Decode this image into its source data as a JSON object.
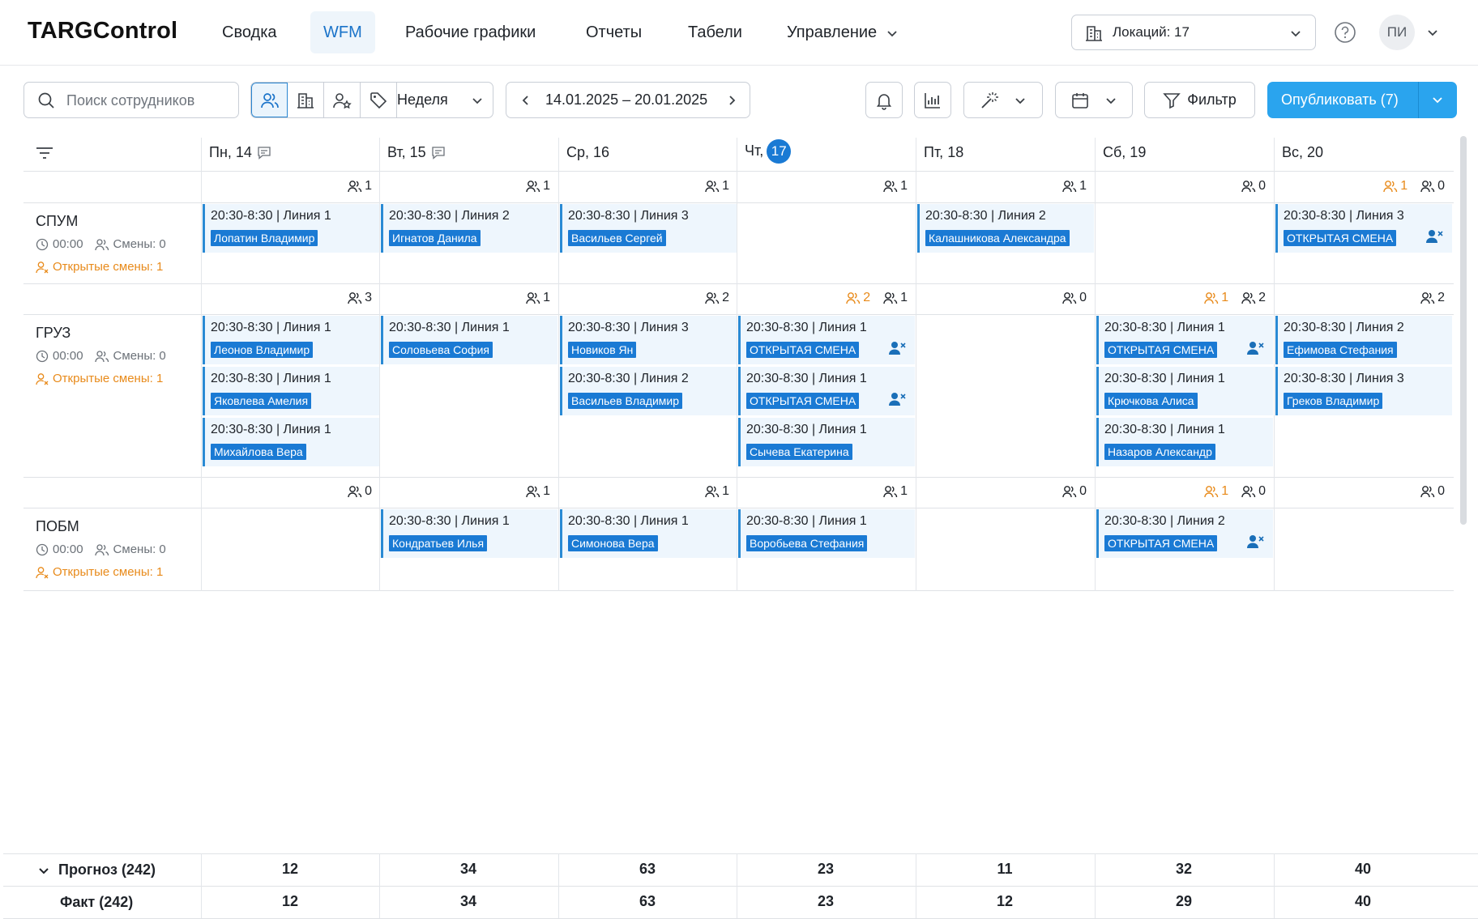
{
  "app": {
    "logo": "TARGControl"
  },
  "nav": {
    "items": [
      {
        "label": "Сводка",
        "active": false
      },
      {
        "label": "WFM",
        "active": true
      },
      {
        "label": "Рабочие графики",
        "active": false
      },
      {
        "label": "Отчеты",
        "active": false
      },
      {
        "label": "Табели",
        "active": false
      },
      {
        "label": "Управление",
        "active": false,
        "has_dropdown": true
      }
    ],
    "locations_label": "Локаций: 17",
    "user_initials": "ПИ"
  },
  "toolbar": {
    "search_placeholder": "Поиск сотрудников",
    "period_label": "Неделя",
    "date_range": "14.01.2025 – 20.01.2025",
    "filter_label": "Фильтр",
    "publish_label": "Опубликовать (7)"
  },
  "colors": {
    "accent": "#1a7ad4",
    "publish": "#2aa4ee",
    "open_shift": "#e88a1a",
    "shift_bg": "#eef6fd"
  },
  "days": [
    {
      "label": "Пн, 14",
      "has_comment": true,
      "today": false
    },
    {
      "label": "Вт, 15",
      "has_comment": true,
      "today": false
    },
    {
      "label": "Ср, 16",
      "has_comment": false,
      "today": false
    },
    {
      "label": "Чт,",
      "date": "17",
      "has_comment": false,
      "today": true
    },
    {
      "label": "Пт, 18",
      "has_comment": false,
      "today": false
    },
    {
      "label": "Сб, 19",
      "has_comment": false,
      "today": false
    },
    {
      "label": "Вс, 20",
      "has_comment": false,
      "today": false
    }
  ],
  "groups": [
    {
      "name": "СПУМ",
      "time": "00:00",
      "shifts_label": "Смены: 0",
      "open_label": "Открытые смены: 1",
      "counts": [
        {
          "open": null,
          "staff": "1"
        },
        {
          "open": null,
          "staff": "1"
        },
        {
          "open": null,
          "staff": "1"
        },
        {
          "open": null,
          "staff": "1"
        },
        {
          "open": null,
          "staff": "1"
        },
        {
          "open": null,
          "staff": "0"
        },
        {
          "open": "1",
          "staff": "0"
        }
      ],
      "cells": [
        [
          {
            "time": "20:30-8:30 | Линия 1",
            "employee": "Лопатин Владимир",
            "open": false
          }
        ],
        [
          {
            "time": "20:30-8:30 | Линия 2",
            "employee": "Игнатов Данила",
            "open": false
          }
        ],
        [
          {
            "time": "20:30-8:30 | Линия 3",
            "employee": "Васильев Сергей",
            "open": false
          }
        ],
        [],
        [
          {
            "time": "20:30-8:30 | Линия 2",
            "employee": "Калашникова Александра",
            "open": false
          }
        ],
        [],
        [
          {
            "time": "20:30-8:30 | Линия 3",
            "employee": "ОТКРЫТАЯ СМЕНА",
            "open": true
          }
        ]
      ]
    },
    {
      "name": "ГРУЗ",
      "time": "00:00",
      "shifts_label": "Смены: 0",
      "open_label": "Открытые смены: 1",
      "counts": [
        {
          "open": null,
          "staff": "3"
        },
        {
          "open": null,
          "staff": "1"
        },
        {
          "open": null,
          "staff": "2"
        },
        {
          "open": "2",
          "staff": "1"
        },
        {
          "open": null,
          "staff": "0"
        },
        {
          "open": "1",
          "staff": "2"
        },
        {
          "open": null,
          "staff": "2"
        }
      ],
      "cells": [
        [
          {
            "time": "20:30-8:30 | Линия 1",
            "employee": "Леонов Владимир",
            "open": false
          },
          {
            "time": "20:30-8:30 | Линия 1",
            "employee": "Яковлева Амелия",
            "open": false
          },
          {
            "time": "20:30-8:30 | Линия 1",
            "employee": "Михайлова Вера",
            "open": false
          }
        ],
        [
          {
            "time": "20:30-8:30 | Линия 1",
            "employee": "Соловьева София",
            "open": false
          }
        ],
        [
          {
            "time": "20:30-8:30 | Линия 3",
            "employee": "Новиков Ян",
            "open": false
          },
          {
            "time": "20:30-8:30 | Линия 2",
            "employee": "Васильев Владимир",
            "open": false
          }
        ],
        [
          {
            "time": "20:30-8:30 | Линия 1",
            "employee": "ОТКРЫТАЯ СМЕНА",
            "open": true
          },
          {
            "time": "20:30-8:30 | Линия 1",
            "employee": "ОТКРЫТАЯ СМЕНА",
            "open": true
          },
          {
            "time": "20:30-8:30 | Линия 1",
            "employee": "Сычева Екатерина",
            "open": false
          }
        ],
        [],
        [
          {
            "time": "20:30-8:30 | Линия 1",
            "employee": "ОТКРЫТАЯ СМЕНА",
            "open": true
          },
          {
            "time": "20:30-8:30 | Линия 1",
            "employee": "Крючкова Алиса",
            "open": false
          },
          {
            "time": "20:30-8:30 | Линия 1",
            "employee": "Назаров Александр",
            "open": false
          }
        ],
        [
          {
            "time": "20:30-8:30 | Линия 2",
            "employee": "Ефимова Стефания",
            "open": false
          },
          {
            "time": "20:30-8:30 | Линия 3",
            "employee": "Греков Владимир",
            "open": false
          }
        ]
      ]
    },
    {
      "name": "ПОБМ",
      "time": "00:00",
      "shifts_label": "Смены: 0",
      "open_label": "Открытые смены: 1",
      "counts": [
        {
          "open": null,
          "staff": "0"
        },
        {
          "open": null,
          "staff": "1"
        },
        {
          "open": null,
          "staff": "1"
        },
        {
          "open": null,
          "staff": "1"
        },
        {
          "open": null,
          "staff": "0"
        },
        {
          "open": "1",
          "staff": "0"
        },
        {
          "open": null,
          "staff": "0"
        }
      ],
      "cells": [
        [],
        [
          {
            "time": "20:30-8:30 | Линия 1",
            "employee": "Кондратьев Илья",
            "open": false
          }
        ],
        [
          {
            "time": "20:30-8:30 | Линия 1",
            "employee": "Симонова Вера",
            "open": false
          }
        ],
        [
          {
            "time": "20:30-8:30 | Линия 1",
            "employee": "Воробьева Стефания",
            "open": false
          }
        ],
        [],
        [
          {
            "time": "20:30-8:30 | Линия 2",
            "employee": "ОТКРЫТАЯ СМЕНА",
            "open": true
          }
        ],
        []
      ]
    }
  ],
  "footer": {
    "forecast_label": "Прогноз (242)",
    "forecast_values": [
      "12",
      "34",
      "63",
      "23",
      "11",
      "32",
      "40"
    ],
    "actual_label": "Факт (242)",
    "actual_values": [
      "12",
      "34",
      "63",
      "23",
      "12",
      "29",
      "40"
    ]
  }
}
